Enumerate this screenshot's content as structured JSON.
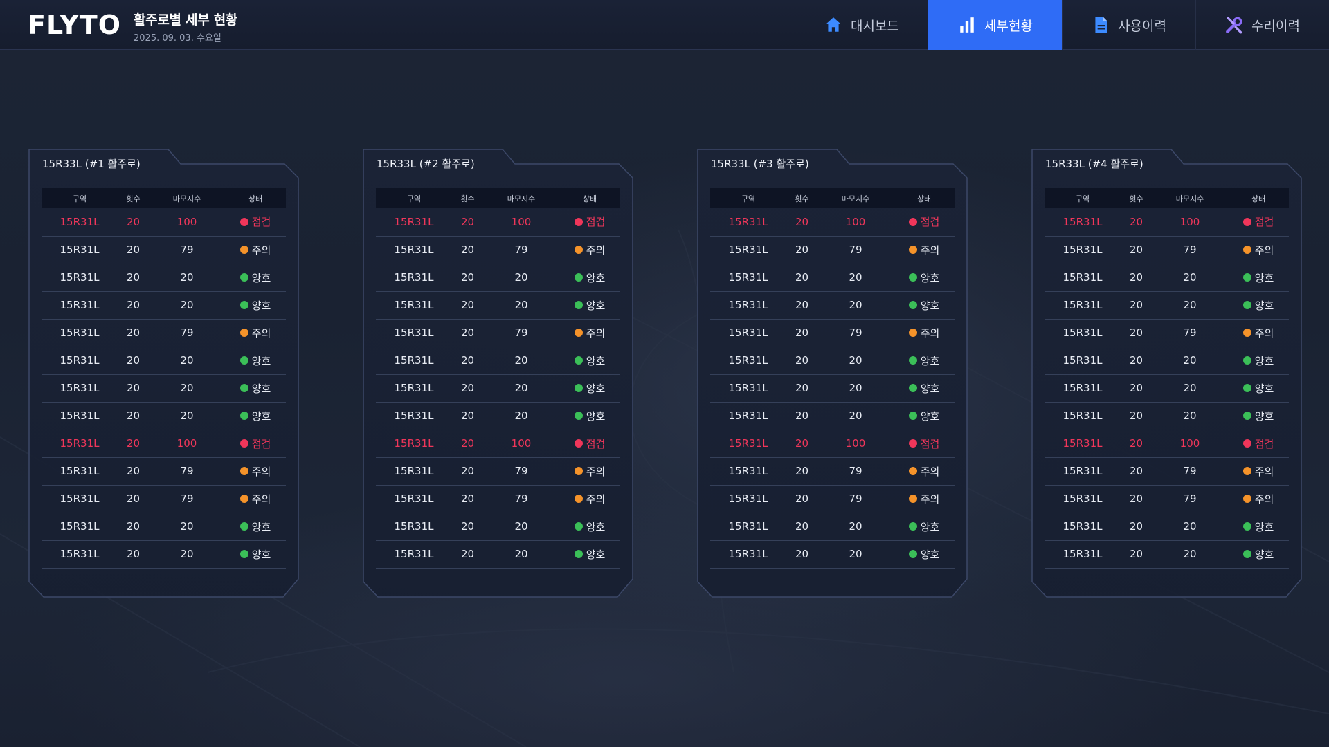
{
  "app": {
    "logo_text": "FLYTO"
  },
  "header": {
    "title": "활주로별 세부 현황",
    "date": "2025. 09. 03. 수요일"
  },
  "nav": [
    {
      "label": "대시보드",
      "icon": "home-icon",
      "active": false,
      "color": "#3d8bff"
    },
    {
      "label": "세부현황",
      "icon": "bar-chart-icon",
      "active": true,
      "color": "#ffffff"
    },
    {
      "label": "사용이력",
      "icon": "document-icon",
      "active": false,
      "color": "#3d8bff"
    },
    {
      "label": "수리이력",
      "icon": "tools-icon",
      "active": false,
      "color": "#8a6cf7"
    }
  ],
  "colors": {
    "accent": "#2f6cf6",
    "status_red": "#f0365a",
    "status_orange": "#f5932a",
    "status_green": "#3bbf58"
  },
  "table_headers": [
    "구역",
    "횟수",
    "마모지수",
    "상태"
  ],
  "panels": [
    {
      "title": "15R33L (#1 활주로)",
      "rows": [
        {
          "zone": "15R31L",
          "count": "20",
          "wear": "100",
          "status": "점검",
          "level": "red"
        },
        {
          "zone": "15R31L",
          "count": "20",
          "wear": "79",
          "status": "주의",
          "level": "orange"
        },
        {
          "zone": "15R31L",
          "count": "20",
          "wear": "20",
          "status": "양호",
          "level": "green"
        },
        {
          "zone": "15R31L",
          "count": "20",
          "wear": "20",
          "status": "양호",
          "level": "green"
        },
        {
          "zone": "15R31L",
          "count": "20",
          "wear": "79",
          "status": "주의",
          "level": "orange"
        },
        {
          "zone": "15R31L",
          "count": "20",
          "wear": "20",
          "status": "양호",
          "level": "green"
        },
        {
          "zone": "15R31L",
          "count": "20",
          "wear": "20",
          "status": "양호",
          "level": "green"
        },
        {
          "zone": "15R31L",
          "count": "20",
          "wear": "20",
          "status": "양호",
          "level": "green"
        },
        {
          "zone": "15R31L",
          "count": "20",
          "wear": "100",
          "status": "점검",
          "level": "red"
        },
        {
          "zone": "15R31L",
          "count": "20",
          "wear": "79",
          "status": "주의",
          "level": "orange"
        },
        {
          "zone": "15R31L",
          "count": "20",
          "wear": "79",
          "status": "주의",
          "level": "orange"
        },
        {
          "zone": "15R31L",
          "count": "20",
          "wear": "20",
          "status": "양호",
          "level": "green"
        },
        {
          "zone": "15R31L",
          "count": "20",
          "wear": "20",
          "status": "양호",
          "level": "green"
        }
      ]
    },
    {
      "title": "15R33L (#2 활주로)",
      "rows": [
        {
          "zone": "15R31L",
          "count": "20",
          "wear": "100",
          "status": "점검",
          "level": "red"
        },
        {
          "zone": "15R31L",
          "count": "20",
          "wear": "79",
          "status": "주의",
          "level": "orange"
        },
        {
          "zone": "15R31L",
          "count": "20",
          "wear": "20",
          "status": "양호",
          "level": "green"
        },
        {
          "zone": "15R31L",
          "count": "20",
          "wear": "20",
          "status": "양호",
          "level": "green"
        },
        {
          "zone": "15R31L",
          "count": "20",
          "wear": "79",
          "status": "주의",
          "level": "orange"
        },
        {
          "zone": "15R31L",
          "count": "20",
          "wear": "20",
          "status": "양호",
          "level": "green"
        },
        {
          "zone": "15R31L",
          "count": "20",
          "wear": "20",
          "status": "양호",
          "level": "green"
        },
        {
          "zone": "15R31L",
          "count": "20",
          "wear": "20",
          "status": "양호",
          "level": "green"
        },
        {
          "zone": "15R31L",
          "count": "20",
          "wear": "100",
          "status": "점검",
          "level": "red"
        },
        {
          "zone": "15R31L",
          "count": "20",
          "wear": "79",
          "status": "주의",
          "level": "orange"
        },
        {
          "zone": "15R31L",
          "count": "20",
          "wear": "79",
          "status": "주의",
          "level": "orange"
        },
        {
          "zone": "15R31L",
          "count": "20",
          "wear": "20",
          "status": "양호",
          "level": "green"
        },
        {
          "zone": "15R31L",
          "count": "20",
          "wear": "20",
          "status": "양호",
          "level": "green"
        }
      ]
    },
    {
      "title": "15R33L (#3 활주로)",
      "rows": [
        {
          "zone": "15R31L",
          "count": "20",
          "wear": "100",
          "status": "점검",
          "level": "red"
        },
        {
          "zone": "15R31L",
          "count": "20",
          "wear": "79",
          "status": "주의",
          "level": "orange"
        },
        {
          "zone": "15R31L",
          "count": "20",
          "wear": "20",
          "status": "양호",
          "level": "green"
        },
        {
          "zone": "15R31L",
          "count": "20",
          "wear": "20",
          "status": "양호",
          "level": "green"
        },
        {
          "zone": "15R31L",
          "count": "20",
          "wear": "79",
          "status": "주의",
          "level": "orange"
        },
        {
          "zone": "15R31L",
          "count": "20",
          "wear": "20",
          "status": "양호",
          "level": "green"
        },
        {
          "zone": "15R31L",
          "count": "20",
          "wear": "20",
          "status": "양호",
          "level": "green"
        },
        {
          "zone": "15R31L",
          "count": "20",
          "wear": "20",
          "status": "양호",
          "level": "green"
        },
        {
          "zone": "15R31L",
          "count": "20",
          "wear": "100",
          "status": "점검",
          "level": "red"
        },
        {
          "zone": "15R31L",
          "count": "20",
          "wear": "79",
          "status": "주의",
          "level": "orange"
        },
        {
          "zone": "15R31L",
          "count": "20",
          "wear": "79",
          "status": "주의",
          "level": "orange"
        },
        {
          "zone": "15R31L",
          "count": "20",
          "wear": "20",
          "status": "양호",
          "level": "green"
        },
        {
          "zone": "15R31L",
          "count": "20",
          "wear": "20",
          "status": "양호",
          "level": "green"
        }
      ]
    },
    {
      "title": "15R33L (#4 활주로)",
      "rows": [
        {
          "zone": "15R31L",
          "count": "20",
          "wear": "100",
          "status": "점검",
          "level": "red"
        },
        {
          "zone": "15R31L",
          "count": "20",
          "wear": "79",
          "status": "주의",
          "level": "orange"
        },
        {
          "zone": "15R31L",
          "count": "20",
          "wear": "20",
          "status": "양호",
          "level": "green"
        },
        {
          "zone": "15R31L",
          "count": "20",
          "wear": "20",
          "status": "양호",
          "level": "green"
        },
        {
          "zone": "15R31L",
          "count": "20",
          "wear": "79",
          "status": "주의",
          "level": "orange"
        },
        {
          "zone": "15R31L",
          "count": "20",
          "wear": "20",
          "status": "양호",
          "level": "green"
        },
        {
          "zone": "15R31L",
          "count": "20",
          "wear": "20",
          "status": "양호",
          "level": "green"
        },
        {
          "zone": "15R31L",
          "count": "20",
          "wear": "20",
          "status": "양호",
          "level": "green"
        },
        {
          "zone": "15R31L",
          "count": "20",
          "wear": "100",
          "status": "점검",
          "level": "red"
        },
        {
          "zone": "15R31L",
          "count": "20",
          "wear": "79",
          "status": "주의",
          "level": "orange"
        },
        {
          "zone": "15R31L",
          "count": "20",
          "wear": "79",
          "status": "주의",
          "level": "orange"
        },
        {
          "zone": "15R31L",
          "count": "20",
          "wear": "20",
          "status": "양호",
          "level": "green"
        },
        {
          "zone": "15R31L",
          "count": "20",
          "wear": "20",
          "status": "양호",
          "level": "green"
        }
      ]
    }
  ]
}
